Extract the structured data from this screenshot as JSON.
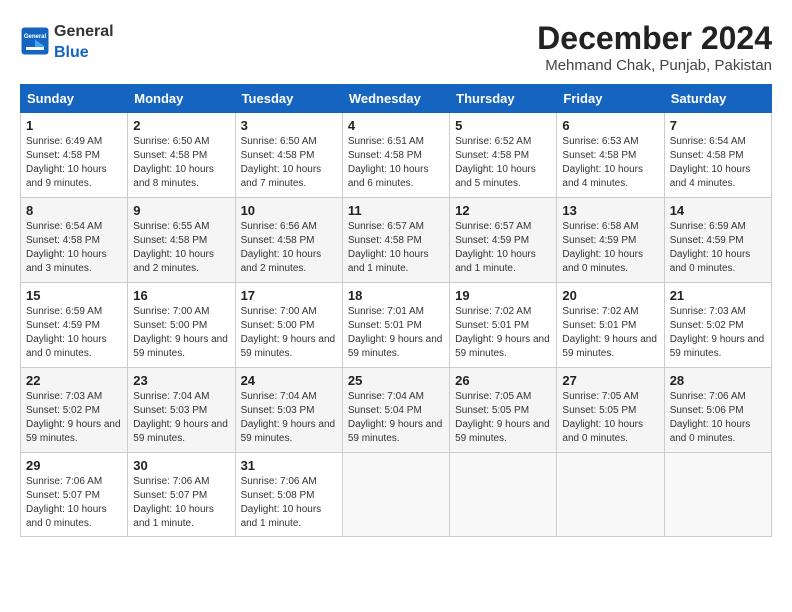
{
  "header": {
    "logo_general": "General",
    "logo_blue": "Blue",
    "month_title": "December 2024",
    "location": "Mehmand Chak, Punjab, Pakistan"
  },
  "days_of_week": [
    "Sunday",
    "Monday",
    "Tuesday",
    "Wednesday",
    "Thursday",
    "Friday",
    "Saturday"
  ],
  "weeks": [
    [
      {
        "day": "1",
        "sunrise": "6:49 AM",
        "sunset": "4:58 PM",
        "daylight": "10 hours and 9 minutes."
      },
      {
        "day": "2",
        "sunrise": "6:50 AM",
        "sunset": "4:58 PM",
        "daylight": "10 hours and 8 minutes."
      },
      {
        "day": "3",
        "sunrise": "6:50 AM",
        "sunset": "4:58 PM",
        "daylight": "10 hours and 7 minutes."
      },
      {
        "day": "4",
        "sunrise": "6:51 AM",
        "sunset": "4:58 PM",
        "daylight": "10 hours and 6 minutes."
      },
      {
        "day": "5",
        "sunrise": "6:52 AM",
        "sunset": "4:58 PM",
        "daylight": "10 hours and 5 minutes."
      },
      {
        "day": "6",
        "sunrise": "6:53 AM",
        "sunset": "4:58 PM",
        "daylight": "10 hours and 4 minutes."
      },
      {
        "day": "7",
        "sunrise": "6:54 AM",
        "sunset": "4:58 PM",
        "daylight": "10 hours and 4 minutes."
      }
    ],
    [
      {
        "day": "8",
        "sunrise": "6:54 AM",
        "sunset": "4:58 PM",
        "daylight": "10 hours and 3 minutes."
      },
      {
        "day": "9",
        "sunrise": "6:55 AM",
        "sunset": "4:58 PM",
        "daylight": "10 hours and 2 minutes."
      },
      {
        "day": "10",
        "sunrise": "6:56 AM",
        "sunset": "4:58 PM",
        "daylight": "10 hours and 2 minutes."
      },
      {
        "day": "11",
        "sunrise": "6:57 AM",
        "sunset": "4:58 PM",
        "daylight": "10 hours and 1 minute."
      },
      {
        "day": "12",
        "sunrise": "6:57 AM",
        "sunset": "4:59 PM",
        "daylight": "10 hours and 1 minute."
      },
      {
        "day": "13",
        "sunrise": "6:58 AM",
        "sunset": "4:59 PM",
        "daylight": "10 hours and 0 minutes."
      },
      {
        "day": "14",
        "sunrise": "6:59 AM",
        "sunset": "4:59 PM",
        "daylight": "10 hours and 0 minutes."
      }
    ],
    [
      {
        "day": "15",
        "sunrise": "6:59 AM",
        "sunset": "4:59 PM",
        "daylight": "10 hours and 0 minutes."
      },
      {
        "day": "16",
        "sunrise": "7:00 AM",
        "sunset": "5:00 PM",
        "daylight": "9 hours and 59 minutes."
      },
      {
        "day": "17",
        "sunrise": "7:00 AM",
        "sunset": "5:00 PM",
        "daylight": "9 hours and 59 minutes."
      },
      {
        "day": "18",
        "sunrise": "7:01 AM",
        "sunset": "5:01 PM",
        "daylight": "9 hours and 59 minutes."
      },
      {
        "day": "19",
        "sunrise": "7:02 AM",
        "sunset": "5:01 PM",
        "daylight": "9 hours and 59 minutes."
      },
      {
        "day": "20",
        "sunrise": "7:02 AM",
        "sunset": "5:01 PM",
        "daylight": "9 hours and 59 minutes."
      },
      {
        "day": "21",
        "sunrise": "7:03 AM",
        "sunset": "5:02 PM",
        "daylight": "9 hours and 59 minutes."
      }
    ],
    [
      {
        "day": "22",
        "sunrise": "7:03 AM",
        "sunset": "5:02 PM",
        "daylight": "9 hours and 59 minutes."
      },
      {
        "day": "23",
        "sunrise": "7:04 AM",
        "sunset": "5:03 PM",
        "daylight": "9 hours and 59 minutes."
      },
      {
        "day": "24",
        "sunrise": "7:04 AM",
        "sunset": "5:03 PM",
        "daylight": "9 hours and 59 minutes."
      },
      {
        "day": "25",
        "sunrise": "7:04 AM",
        "sunset": "5:04 PM",
        "daylight": "9 hours and 59 minutes."
      },
      {
        "day": "26",
        "sunrise": "7:05 AM",
        "sunset": "5:05 PM",
        "daylight": "9 hours and 59 minutes."
      },
      {
        "day": "27",
        "sunrise": "7:05 AM",
        "sunset": "5:05 PM",
        "daylight": "10 hours and 0 minutes."
      },
      {
        "day": "28",
        "sunrise": "7:06 AM",
        "sunset": "5:06 PM",
        "daylight": "10 hours and 0 minutes."
      }
    ],
    [
      {
        "day": "29",
        "sunrise": "7:06 AM",
        "sunset": "5:07 PM",
        "daylight": "10 hours and 0 minutes."
      },
      {
        "day": "30",
        "sunrise": "7:06 AM",
        "sunset": "5:07 PM",
        "daylight": "10 hours and 1 minute."
      },
      {
        "day": "31",
        "sunrise": "7:06 AM",
        "sunset": "5:08 PM",
        "daylight": "10 hours and 1 minute."
      },
      null,
      null,
      null,
      null
    ]
  ],
  "labels": {
    "sunrise": "Sunrise:",
    "sunset": "Sunset:",
    "daylight": "Daylight:"
  }
}
